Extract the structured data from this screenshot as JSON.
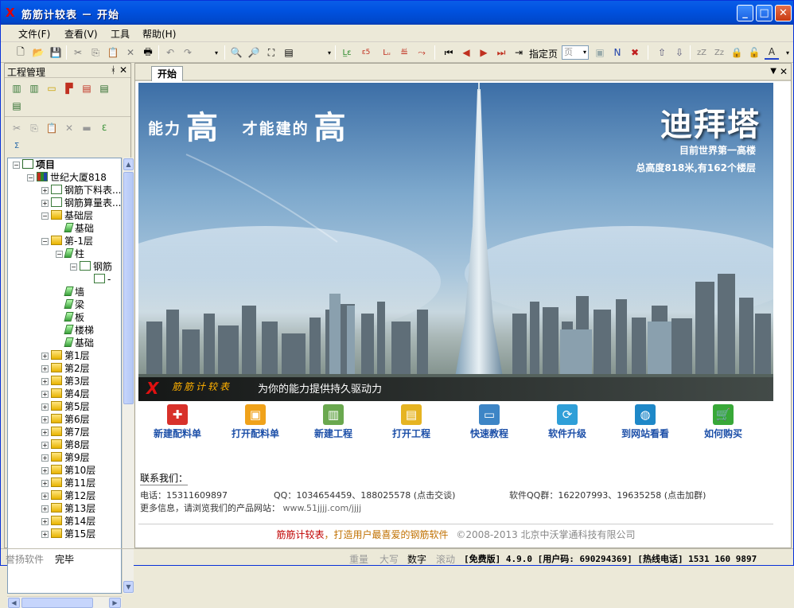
{
  "window": {
    "title": "筋筋计较表 － 开始",
    "app_icon": "X"
  },
  "menu": [
    "文件(F)",
    "查看(V)",
    "工具",
    "帮助(H)"
  ],
  "toolbar": {
    "page_label": "指定页",
    "page_value": "页",
    "zz1": "zZ",
    "zz2": "Zz",
    "text_A": "A"
  },
  "pane": {
    "title": "工程管理",
    "pin": "ᚼ",
    "close": "✕"
  },
  "tree": [
    {
      "label": "项目",
      "level": 0,
      "expand": "−",
      "icon": "list",
      "bold": true
    },
    {
      "label": "世纪大厦818",
      "level": 1,
      "expand": "−",
      "icon": "chart"
    },
    {
      "label": "钢筋下料表...",
      "level": 2,
      "expand": "+",
      "icon": "doc"
    },
    {
      "label": "钢筋算量表...",
      "level": 2,
      "expand": "+",
      "icon": "doc"
    },
    {
      "label": "基础层",
      "level": 2,
      "expand": "−",
      "icon": "folder"
    },
    {
      "label": "基础",
      "level": 3,
      "expand": "",
      "icon": "leaf"
    },
    {
      "label": "第-1层",
      "level": 2,
      "expand": "−",
      "icon": "folder"
    },
    {
      "label": "柱",
      "level": 3,
      "expand": "−",
      "icon": "leaf"
    },
    {
      "label": "钢筋",
      "level": 4,
      "expand": "−",
      "icon": "doc"
    },
    {
      "label": "-",
      "level": 5,
      "expand": "",
      "icon": "doc"
    },
    {
      "label": "墙",
      "level": 3,
      "expand": "",
      "icon": "leaf"
    },
    {
      "label": "梁",
      "level": 3,
      "expand": "",
      "icon": "leaf"
    },
    {
      "label": "板",
      "level": 3,
      "expand": "",
      "icon": "leaf"
    },
    {
      "label": "楼梯",
      "level": 3,
      "expand": "",
      "icon": "leaf"
    },
    {
      "label": "基础",
      "level": 3,
      "expand": "",
      "icon": "leaf"
    },
    {
      "label": "第1层",
      "level": 2,
      "expand": "+",
      "icon": "folder"
    },
    {
      "label": "第2层",
      "level": 2,
      "expand": "+",
      "icon": "folder"
    },
    {
      "label": "第3层",
      "level": 2,
      "expand": "+",
      "icon": "folder"
    },
    {
      "label": "第4层",
      "level": 2,
      "expand": "+",
      "icon": "folder"
    },
    {
      "label": "第5层",
      "level": 2,
      "expand": "+",
      "icon": "folder"
    },
    {
      "label": "第6层",
      "level": 2,
      "expand": "+",
      "icon": "folder"
    },
    {
      "label": "第7层",
      "level": 2,
      "expand": "+",
      "icon": "folder"
    },
    {
      "label": "第8层",
      "level": 2,
      "expand": "+",
      "icon": "folder"
    },
    {
      "label": "第9层",
      "level": 2,
      "expand": "+",
      "icon": "folder"
    },
    {
      "label": "第10层",
      "level": 2,
      "expand": "+",
      "icon": "folder"
    },
    {
      "label": "第11层",
      "level": 2,
      "expand": "+",
      "icon": "folder"
    },
    {
      "label": "第12层",
      "level": 2,
      "expand": "+",
      "icon": "folder"
    },
    {
      "label": "第13层",
      "level": 2,
      "expand": "+",
      "icon": "folder"
    },
    {
      "label": "第14层",
      "level": 2,
      "expand": "+",
      "icon": "folder"
    },
    {
      "label": "第15层",
      "level": 2,
      "expand": "+",
      "icon": "folder"
    }
  ],
  "tab": {
    "label": "开始"
  },
  "banner": {
    "slogan_a": "能力",
    "slogan_big1": "高",
    "slogan_b": "才能建的",
    "slogan_big2": "高",
    "building": "迪拜塔",
    "sub1": "目前世界第一高楼",
    "sub2": "总高度818米,有162个楼层",
    "logo_text": "筋筋计较表",
    "tagline": "为你的能力提供持久驱动力"
  },
  "actions": [
    {
      "label": "新建配料单",
      "icon": "new-list-icon",
      "color": "#d8312a"
    },
    {
      "label": "打开配料单",
      "icon": "open-list-icon",
      "color": "#f0a21a"
    },
    {
      "label": "新建工程",
      "icon": "new-project-icon",
      "color": "#6aa84f"
    },
    {
      "label": "打开工程",
      "icon": "open-project-icon",
      "color": "#e6b422"
    },
    {
      "label": "快速教程",
      "icon": "tutorial-icon",
      "color": "#3d85c6"
    },
    {
      "label": "软件升级",
      "icon": "upgrade-icon",
      "color": "#2f9fd8"
    },
    {
      "label": "到网站看看",
      "icon": "website-icon",
      "color": "#1e88c8"
    },
    {
      "label": "如何购买",
      "icon": "cart-icon",
      "color": "#38a838"
    }
  ],
  "contact": {
    "title": "联系我们：",
    "phone": "电话：15311609897",
    "qq": "QQ：1034654459、188025578 (点击交谈)",
    "group": "软件QQ群：162207993、19635258 (点击加群)",
    "more": "更多信息，请浏览我们的产品网站：",
    "url": "www.51jjjj.com/jjjj"
  },
  "footer": {
    "brand": "筋筋计较表",
    "slogan": "，打造用户最喜爱的钢筋软件",
    "copy": "©2008-2013 北京中沃掌通科技有限公司"
  },
  "status": {
    "left1": "誉扬软件",
    "left2": "完毕",
    "caps1": "重量",
    "caps2": "大写",
    "caps3": "数字",
    "caps4": "滚动",
    "edition": "[免费版] 4.9.0 [用户码: 690294369] [热线电话] 1531 160 9897"
  }
}
